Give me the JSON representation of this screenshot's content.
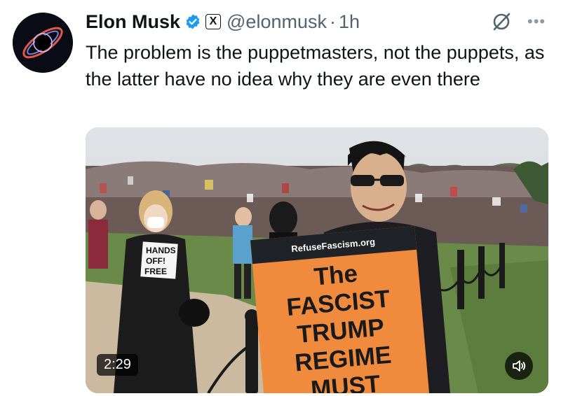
{
  "author": {
    "name": "Elon Musk",
    "handle": "@elonmusk",
    "separator": "·",
    "time": "1h",
    "x_badge": "X"
  },
  "tweet": {
    "text": "The problem is the puppetmasters, not the puppets, as the latter have no idea why they are even there"
  },
  "media": {
    "type": "video",
    "duration": "2:29",
    "sign_org": "RefuseFascism.org",
    "sign_lines": [
      "The",
      "FASCIST",
      "TRUMP",
      "REGIME",
      "MUST"
    ],
    "small_sign_lines": [
      "HANDS",
      "OFF!",
      "FREE"
    ]
  },
  "icons": {
    "verified": "verified-badge-icon",
    "grok": "grok-icon",
    "more": "more-icon",
    "volume": "volume-icon"
  },
  "colors": {
    "verified_blue": "#1d9bf0",
    "secondary_text": "#536471",
    "sign_orange": "#f08a3c"
  }
}
